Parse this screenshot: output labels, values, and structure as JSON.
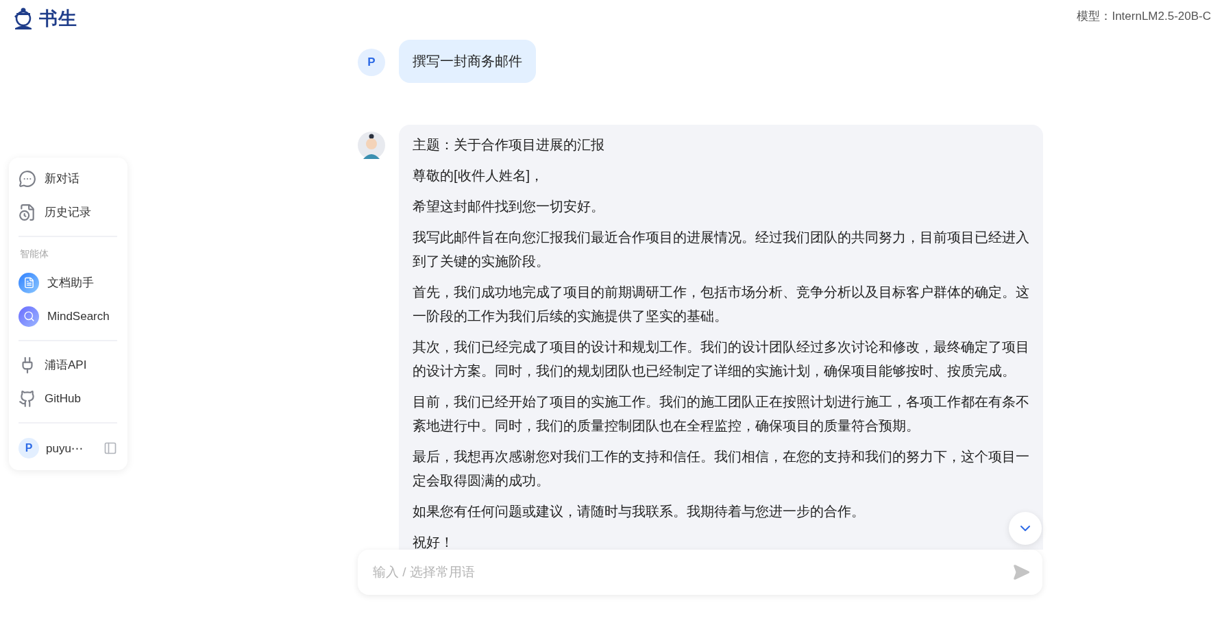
{
  "header": {
    "logo_text": "书生",
    "model_label": "模型：InternLM2.5-20B-C"
  },
  "sidebar": {
    "items": [
      {
        "kind": "chat",
        "label": "新对话"
      },
      {
        "kind": "history",
        "label": "历史记录"
      }
    ],
    "section_title": "智能体",
    "agents": [
      {
        "kind": "doc",
        "label": "文档助手"
      },
      {
        "kind": "search",
        "label": "MindSearch"
      }
    ],
    "links": [
      {
        "kind": "api",
        "label": "浦语API"
      },
      {
        "kind": "github",
        "label": "GitHub"
      }
    ],
    "user": {
      "initial": "P",
      "name": "puyu⋯"
    }
  },
  "messages": [
    {
      "kind": "user",
      "avatar": "P",
      "paragraphs": [
        "撰写一封商务邮件"
      ]
    },
    {
      "kind": "assistant",
      "paragraphs": [
        "主题：关于合作项目进展的汇报",
        "尊敬的[收件人姓名]，",
        "希望这封邮件找到您一切安好。",
        "我写此邮件旨在向您汇报我们最近合作项目的进展情况。经过我们团队的共同努力，目前项目已经进入到了关键的实施阶段。",
        "首先，我们成功地完成了项目的前期调研工作，包括市场分析、竞争分析以及目标客户群体的确定。这一阶段的工作为我们后续的实施提供了坚实的基础。",
        "其次，我们已经完成了项目的设计和规划工作。我们的设计团队经过多次讨论和修改，最终确定了项目的设计方案。同时，我们的规划团队也已经制定了详细的实施计划，确保项目能够按时、按质完成。",
        "目前，我们已经开始了项目的实施工作。我们的施工团队正在按照计划进行施工，各项工作都在有条不紊地进行中。同时，我们的质量控制团队也在全程监控，确保项目的质量符合预期。",
        "最后，我想再次感谢您对我们工作的支持和信任。我们相信，在您的支持和我们的努力下，这个项目一定会取得圆满的成功。",
        "如果您有任何问题或建议，请随时与我联系。我期待着与您进一步的合作。",
        "祝好！"
      ]
    }
  ],
  "input": {
    "placeholder": "输入 / 选择常用语"
  }
}
